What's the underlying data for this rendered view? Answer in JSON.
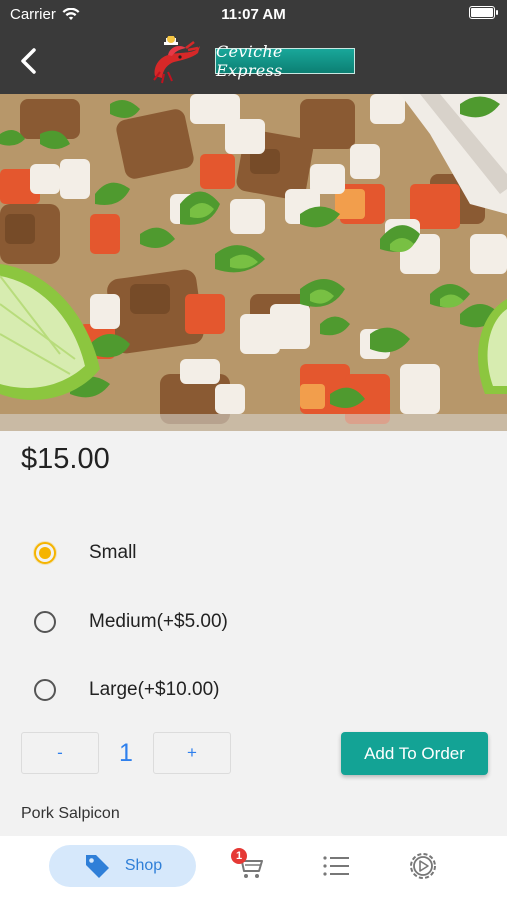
{
  "status_bar": {
    "carrier": "Carrier",
    "time": "11:07 AM"
  },
  "header": {
    "logo_text": "Ceviche Express",
    "back_icon": "chevron-left-icon"
  },
  "product": {
    "price": "$15.00",
    "name": "Pork Salpicon",
    "sizes": [
      {
        "label": "Small",
        "selected": true
      },
      {
        "label": "Medium(+$5.00)",
        "selected": false
      },
      {
        "label": "Large(+$10.00)",
        "selected": false
      }
    ],
    "quantity": "1",
    "decrement_label": "-",
    "increment_label": "+",
    "add_button_label": "Add To Order"
  },
  "tab_bar": {
    "shop_label": "Shop",
    "cart_badge": "1",
    "icons": [
      "tag-icon",
      "cart-icon",
      "list-icon",
      "settings-icon"
    ]
  },
  "colors": {
    "header_bg": "#3a3a3a",
    "accent_teal": "#13a395",
    "radio_selected": "#f5b400",
    "link_blue": "#2f80ed",
    "badge_red": "#e53935"
  }
}
